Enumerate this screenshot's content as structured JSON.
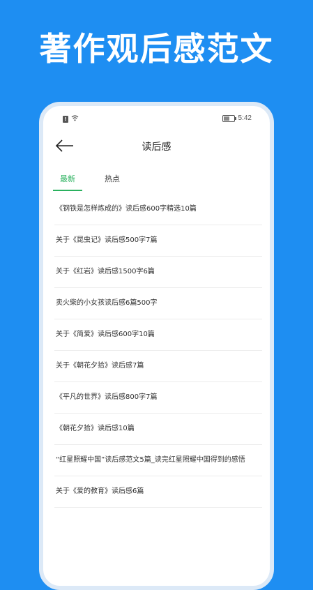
{
  "banner": {
    "title": "著作观后感范文"
  },
  "status_bar": {
    "time": "5:42",
    "sim_label": "!"
  },
  "header": {
    "title": "读后感"
  },
  "tabs": [
    {
      "label": "最新",
      "active": true
    },
    {
      "label": "热点",
      "active": false
    }
  ],
  "items": [
    "《钢铁是怎样炼成的》读后感600字精选10篇",
    "关于《昆虫记》读后感500字7篇",
    "关于《红岩》读后感1500字6篇",
    "卖火柴的小女孩读后感6篇500字",
    "关于《简爱》读后感600字10篇",
    "关于《朝花夕拾》读后感7篇",
    "《平凡的世界》读后感800字7篇",
    "《朝花夕拾》读后感10篇",
    "“红星照耀中国”读后感范文5篇_读完红星照耀中国得到的感悟",
    "关于《爱的教育》读后感6篇"
  ],
  "colors": {
    "background": "#1E8EF2",
    "accent": "#2AB15E"
  }
}
